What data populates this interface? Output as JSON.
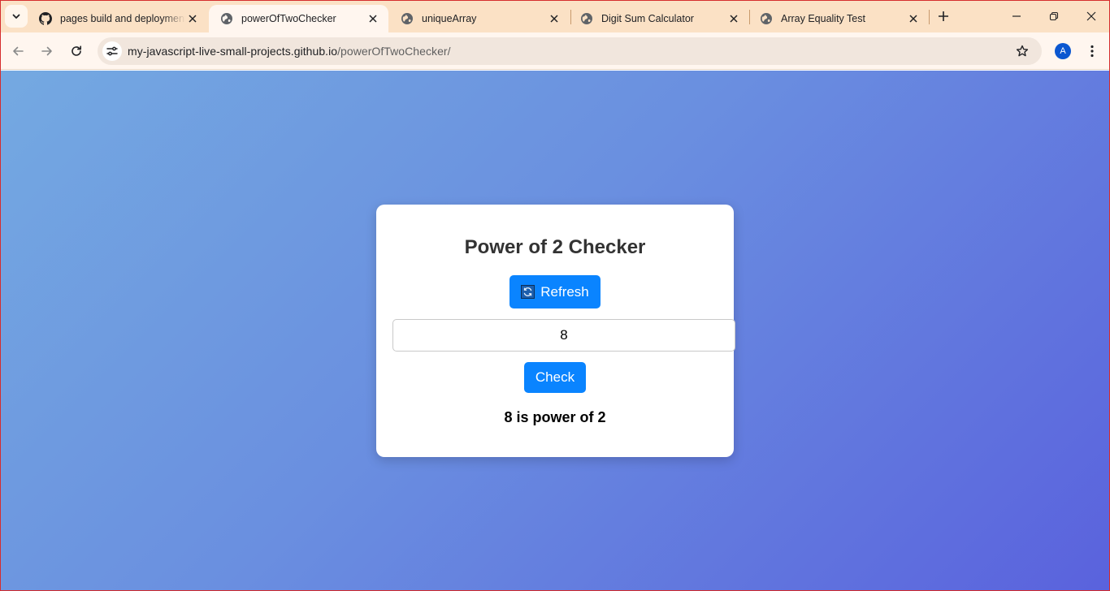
{
  "browser": {
    "tabs": [
      {
        "title": "pages build and deployment",
        "icon": "github-icon"
      },
      {
        "title": "powerOfTwoChecker",
        "icon": "globe-icon",
        "active": true
      },
      {
        "title": "uniqueArray",
        "icon": "globe-icon"
      },
      {
        "title": "Digit Sum Calculator",
        "icon": "globe-icon"
      },
      {
        "title": "Array Equality Test",
        "icon": "globe-icon"
      }
    ],
    "url_domain": "my-javascript-live-small-projects.github.io",
    "url_path": "/powerOfTwoChecker/",
    "profile_initial": "A",
    "accent": "#fbe1c5"
  },
  "page": {
    "title": "Power of 2 Checker",
    "refresh_label": "Refresh",
    "input_value": "8",
    "check_label": "Check",
    "result": "8 is power of 2",
    "button_color": "#0a84ff"
  }
}
